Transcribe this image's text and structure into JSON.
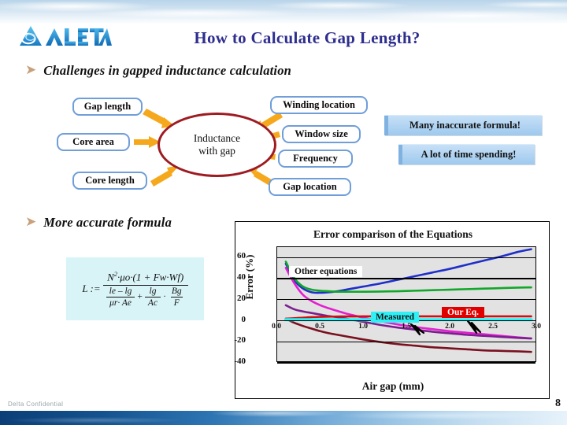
{
  "slide": {
    "title": "How to Calculate Gap Length?",
    "page_number": "8",
    "confidential": "Delta Confidential",
    "logo_text": "DELTA",
    "bullet_glyph": "➤"
  },
  "bullets": [
    {
      "text": "Challenges in gapped inductance calculation"
    },
    {
      "text": "More accurate formula"
    }
  ],
  "mindmap": {
    "center_line1": "Inductance",
    "center_line2": "with gap",
    "left_items": [
      {
        "label": "Gap length"
      },
      {
        "label": "Core area"
      },
      {
        "label": "Core length"
      }
    ],
    "right_items": [
      {
        "label": "Winding location"
      },
      {
        "label": "Window size"
      },
      {
        "label": "Frequency"
      },
      {
        "label": "Gap location"
      }
    ]
  },
  "callouts": [
    {
      "text": "Many inaccurate formula!"
    },
    {
      "text": "A lot of time spending!"
    }
  ],
  "formula": {
    "lhs": "L :=",
    "numerator_N": "N",
    "numerator_N_exp": "2",
    "numerator_rest": "·μo·(1 + Fw·Wf)",
    "den_left_num": "le – lg",
    "den_left_den": "μr· Ae",
    "den_plus": "+",
    "den_right_num1": "lg",
    "den_right_den1": "Ac",
    "den_dot": "·",
    "den_right_num2": "Bg",
    "den_right_den2": "F"
  },
  "chart_data": {
    "type": "line",
    "title": "Error comparison of the Equations",
    "xlabel": "Air gap (mm)",
    "ylabel": "Error (%)",
    "xlim": [
      0.0,
      3.0
    ],
    "ylim": [
      -40,
      70
    ],
    "grid": true,
    "legend_position": "inline-annotations",
    "xticks": [
      "0.0",
      "0.5",
      "1.0",
      "1.5",
      "2.0",
      "2.5",
      "3.0"
    ],
    "yticks": [
      "60",
      "40",
      "20",
      "0",
      "-20",
      "-40"
    ],
    "annotations": [
      {
        "text": "Other equations",
        "x": 0.55,
        "y": 48,
        "style": "white-box"
      },
      {
        "text": "Measured",
        "x": 1.45,
        "y": 8,
        "style": "cyan-box"
      },
      {
        "text": "Our Eq.",
        "x": 2.25,
        "y": 12,
        "style": "red-box"
      }
    ],
    "x": [
      0.1,
      0.2,
      0.3,
      0.4,
      0.5,
      0.6,
      0.7,
      0.8,
      0.9,
      1.0,
      1.2,
      1.4,
      1.6,
      1.8,
      2.0,
      2.2,
      2.4,
      2.6,
      2.8,
      2.95
    ],
    "series": [
      {
        "name": "Other equation (blue)",
        "color": "#1f2fc8",
        "values": [
          54,
          38,
          30,
          26.5,
          26,
          26.5,
          27.5,
          29,
          30.5,
          32,
          35,
          38.5,
          42,
          45.5,
          49,
          53,
          57,
          61,
          65.5,
          68
        ]
      },
      {
        "name": "Other equation (green)",
        "color": "#11a72a",
        "values": [
          56,
          40,
          32,
          29,
          28,
          27.5,
          27,
          27,
          27,
          27,
          27.2,
          27.5,
          28,
          28.5,
          29,
          29.5,
          30,
          30.5,
          31,
          31.2
        ]
      },
      {
        "name": "Other equation (magenta)",
        "color": "#e31fd0",
        "values": [
          50,
          35,
          24,
          18,
          14,
          11,
          8.5,
          6,
          4,
          2,
          -1.5,
          -4.5,
          -7,
          -9,
          -11,
          -12.5,
          -14,
          -15.5,
          -17,
          -18
        ]
      },
      {
        "name": "Other equation (purple)",
        "color": "#7b1f8f",
        "values": [
          14,
          10,
          8,
          6.5,
          5,
          3.5,
          2.5,
          1,
          -0.5,
          -2,
          -5,
          -7.5,
          -9.5,
          -11.5,
          -13,
          -14.5,
          -15.5,
          -16.5,
          -17.5,
          -18
        ]
      },
      {
        "name": "Other equation (dark red)",
        "color": "#7a1020",
        "values": [
          1,
          -3,
          -6,
          -8.5,
          -11,
          -13,
          -14.5,
          -16,
          -17.5,
          -19,
          -21.5,
          -23.5,
          -25,
          -26.5,
          -27.5,
          -28.5,
          -29.5,
          -30,
          -30.5,
          -31
        ]
      },
      {
        "name": "Our Eq.",
        "color": "#cc1111",
        "values": [
          1,
          1.5,
          2,
          2.5,
          2.8,
          3,
          3.1,
          3.2,
          3.2,
          3.3,
          3.3,
          3.3,
          3.3,
          3.3,
          3.3,
          3.3,
          3.3,
          3.3,
          3.3,
          3.3
        ]
      },
      {
        "name": "Measured",
        "color": "#2ff0f5",
        "values": [
          0,
          0,
          0,
          0,
          0,
          0,
          0,
          0,
          0,
          0,
          0,
          0,
          0,
          0,
          0,
          0,
          0,
          0,
          0,
          0
        ]
      }
    ]
  }
}
